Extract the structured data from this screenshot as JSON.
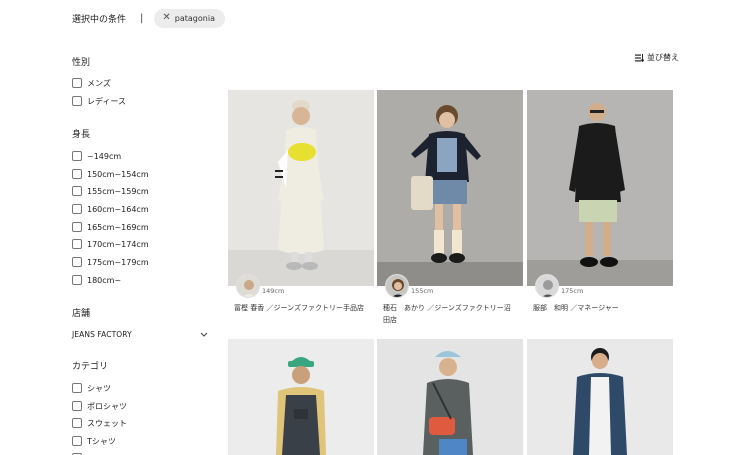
{
  "conditions": {
    "label": "選択中の条件",
    "separator": "|",
    "chips": [
      {
        "close": "✕",
        "label": "patagonia"
      }
    ]
  },
  "sort": {
    "label": "並び替え",
    "icon": "sort-icon"
  },
  "filters": {
    "gender": {
      "title": "性別",
      "options": [
        "メンズ",
        "レディース"
      ]
    },
    "height": {
      "title": "身長",
      "options": [
        "~149cm",
        "150cm~154cm",
        "155cm~159cm",
        "160cm~164cm",
        "165cm~169cm",
        "170cm~174cm",
        "175cm~179cm",
        "180cm~"
      ]
    },
    "store": {
      "title": "店舗",
      "selected": "JEANS FACTORY",
      "icon": "chevron-down-icon"
    },
    "category": {
      "title": "カテゴリ",
      "options": [
        "シャツ",
        "ポロシャツ",
        "スウェット",
        "Tシャツ"
      ]
    }
  },
  "cards": [
    {
      "height": "149cm",
      "name": "冨樫 春香 ／ジーンズファクトリー手品店",
      "icon": "staff-avatar",
      "colors": {
        "bg": "#e6e5e2",
        "outfit": "#efece2",
        "accent": "#e8e030"
      }
    },
    {
      "height": "155cm",
      "name": "穂石　あかり ／ジーンズファクトリー沼田店",
      "icon": "staff-avatar",
      "colors": {
        "bg": "#a9a7a3",
        "outfit": "#1d2230",
        "accent": "#8aa4c2"
      }
    },
    {
      "height": "175cm",
      "name": "服部　和明 ／マネージャー",
      "icon": "staff-avatar",
      "colors": {
        "bg": "#b6b5b3",
        "outfit": "#1b1b1b",
        "accent": "#c9d4b3"
      }
    },
    {
      "height": "",
      "name": "",
      "icon": "staff-avatar",
      "colors": {
        "bg": "#ececec",
        "outfit": "#3a4048",
        "accent": "#3aa680"
      }
    },
    {
      "height": "",
      "name": "",
      "icon": "staff-avatar",
      "colors": {
        "bg": "#e4e4e4",
        "outfit": "#5a6060",
        "accent": "#e05a40"
      }
    },
    {
      "height": "",
      "name": "",
      "icon": "staff-avatar",
      "colors": {
        "bg": "#e9e9e9",
        "outfit": "#2f4a68",
        "accent": "#f2f2f2"
      }
    }
  ]
}
